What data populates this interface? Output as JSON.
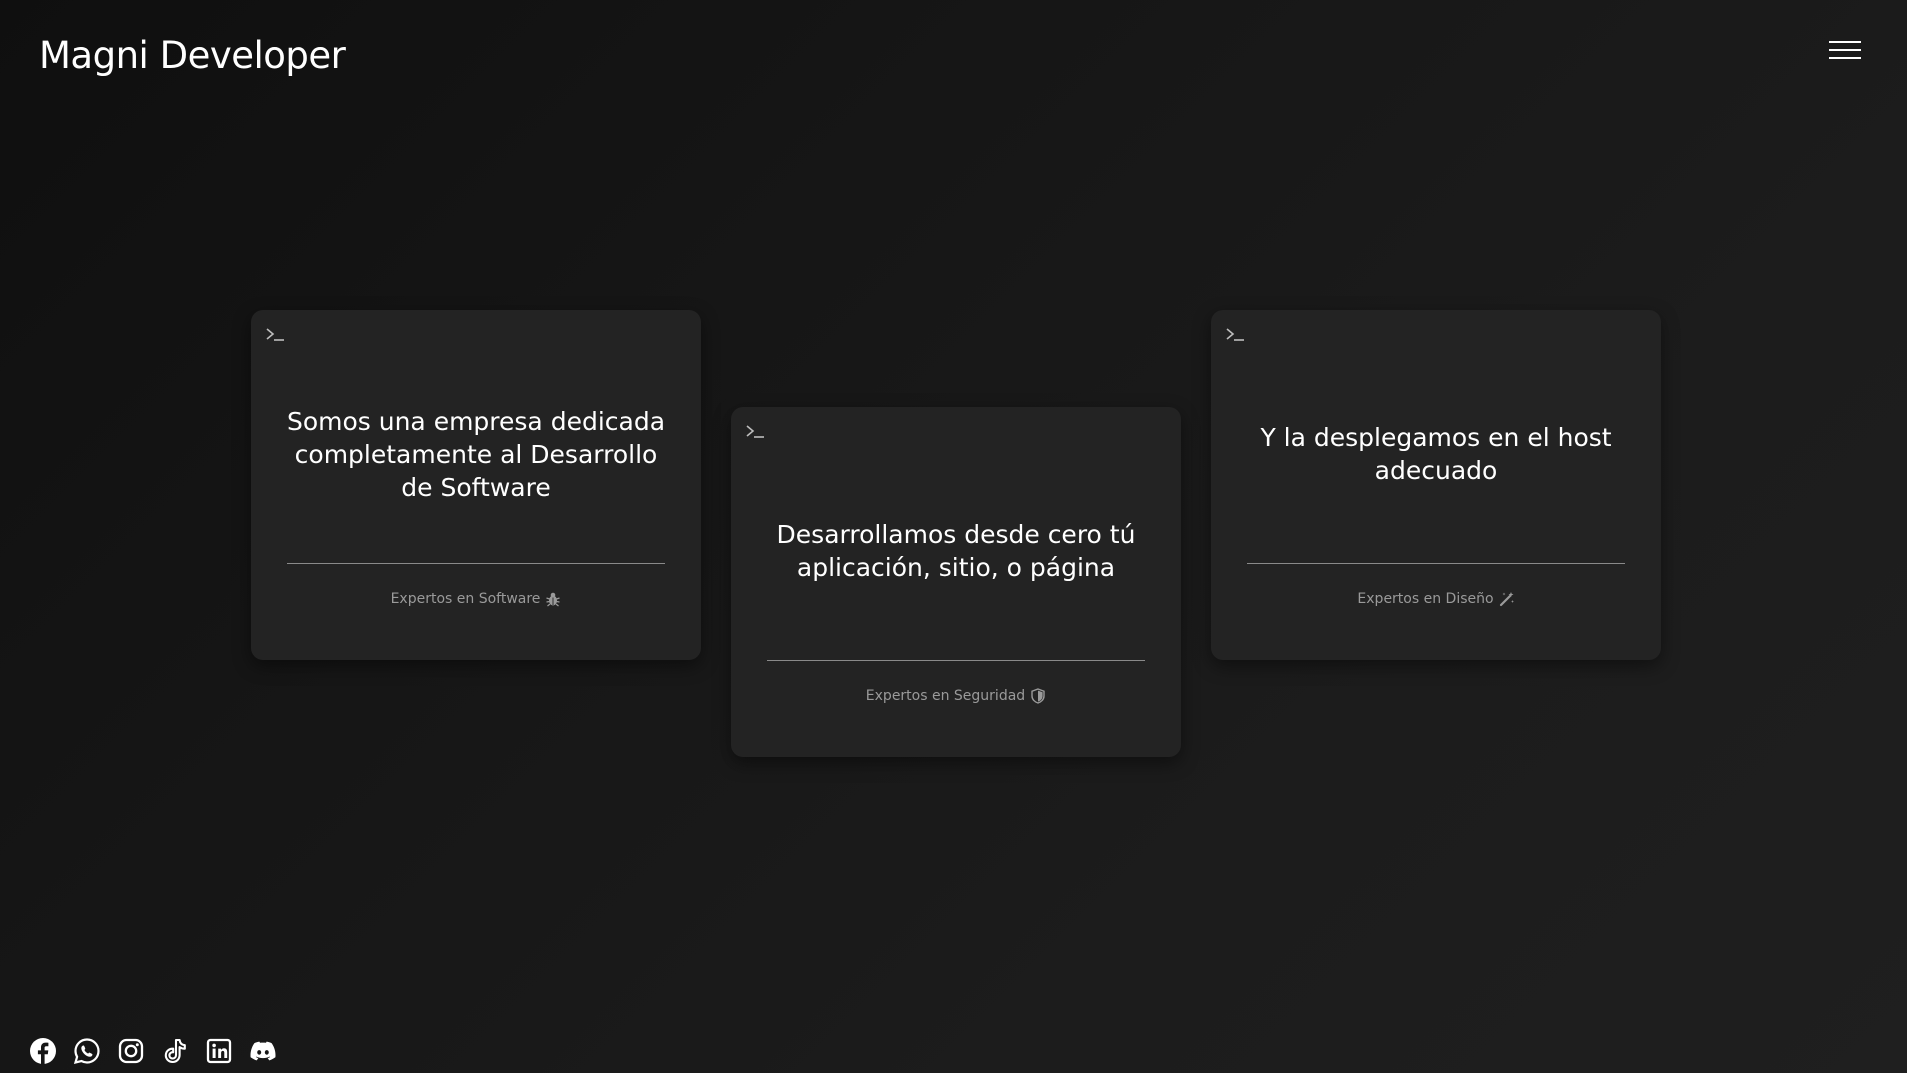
{
  "header": {
    "brand": "Magni Developer",
    "menu_icon": "hamburger-menu-icon"
  },
  "cards": [
    {
      "icon": "terminal-prompt-icon",
      "text": "Somos una empresa dedicada completamente al Desarrollo de Software",
      "footer": "Expertos en Software",
      "footer_icon": "bug-icon"
    },
    {
      "icon": "terminal-prompt-icon",
      "text": "Desarrollamos desde cero tú aplicación, sitio, o página",
      "footer": "Expertos en Seguridad",
      "footer_icon": "shield-icon"
    },
    {
      "icon": "terminal-prompt-icon",
      "text": "Y la desplegamos en el host adecuado",
      "footer": "Expertos en Diseño",
      "footer_icon": "magic-wand-icon"
    }
  ],
  "socials": [
    {
      "icon": "facebook-icon"
    },
    {
      "icon": "whatsapp-icon"
    },
    {
      "icon": "instagram-icon"
    },
    {
      "icon": "tiktok-icon"
    },
    {
      "icon": "linkedin-icon"
    },
    {
      "icon": "discord-icon"
    }
  ],
  "colors": {
    "background": "#161616",
    "card": "#232323",
    "text": "#ffffff",
    "muted": "#9a9a9a",
    "divider": "#8a8a8a"
  }
}
